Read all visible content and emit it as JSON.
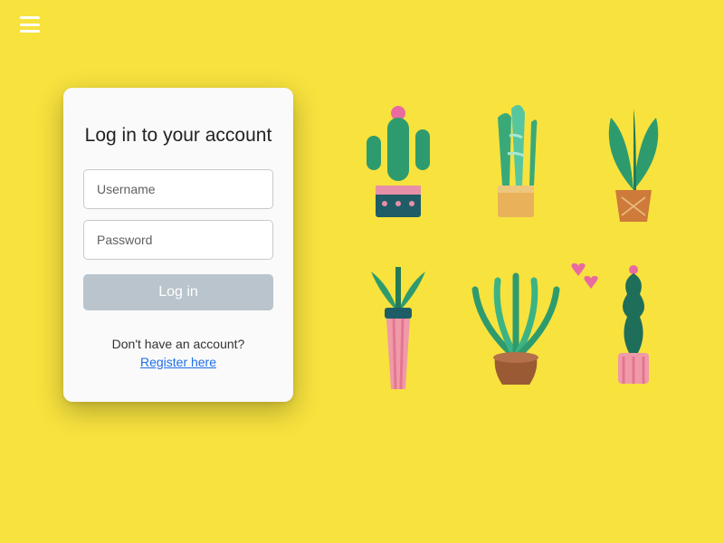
{
  "login": {
    "title": "Log in to your account",
    "username_placeholder": "Username",
    "password_placeholder": "Password",
    "button_label": "Log in",
    "register_prompt": "Don't have an account?",
    "register_link": "Register here"
  },
  "icons": {
    "menu": "hamburger-menu-icon"
  }
}
